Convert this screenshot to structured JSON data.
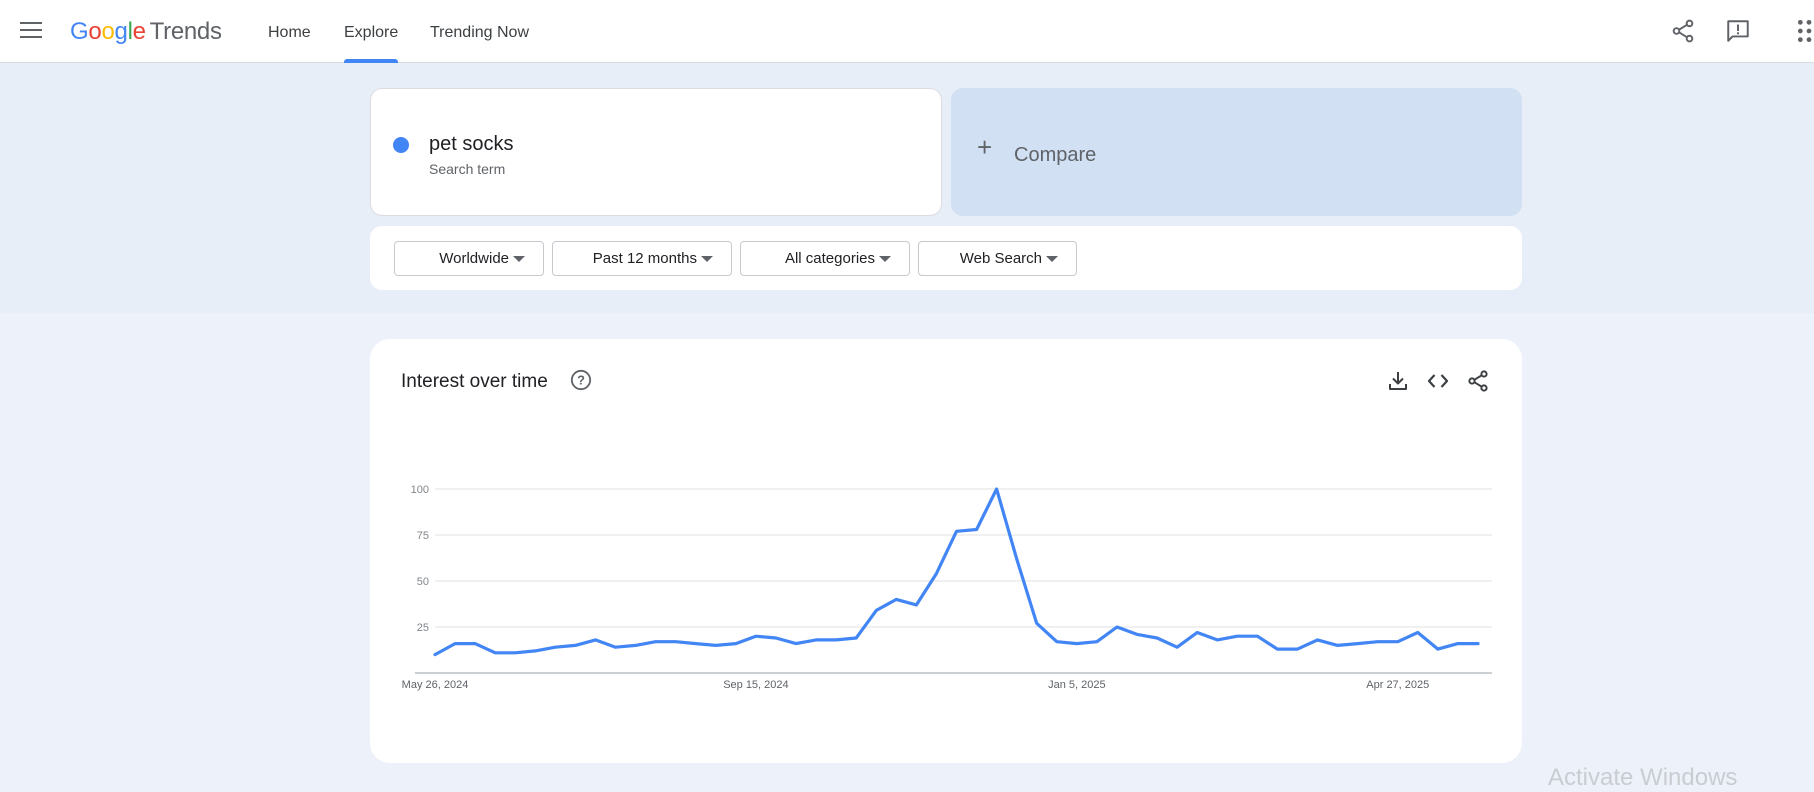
{
  "header": {
    "logo": {
      "letters": [
        "G",
        "o",
        "o",
        "g",
        "l",
        "e"
      ],
      "product": "Trends"
    },
    "nav": [
      {
        "label": "Home",
        "active": false
      },
      {
        "label": "Explore",
        "active": true
      },
      {
        "label": "Trending Now",
        "active": false
      }
    ],
    "icons": [
      "menu-icon",
      "share-icon",
      "feedback-icon",
      "apps-icon"
    ]
  },
  "search_term": {
    "name": "pet socks",
    "type": "Search term",
    "color": "#4285f4"
  },
  "compare": {
    "label": "Compare"
  },
  "filters": [
    {
      "label": "Worldwide"
    },
    {
      "label": "Past 12 months"
    },
    {
      "label": "All categories"
    },
    {
      "label": "Web Search"
    }
  ],
  "interest": {
    "title": "Interest over time",
    "tools": [
      "download-icon",
      "embed-icon",
      "share-icon"
    ]
  },
  "chart_data": {
    "type": "line",
    "title": "Interest over time",
    "xlabel": "",
    "ylabel": "",
    "ylim": [
      0,
      100
    ],
    "yticks": [
      25,
      50,
      75,
      100
    ],
    "x_tick_labels": [
      "May 26, 2024",
      "Sep 15, 2024",
      "Jan 5, 2025",
      "Apr 27, 2025"
    ],
    "x_tick_indices": [
      0,
      16,
      32,
      48
    ],
    "grid": true,
    "legend": "none",
    "series": [
      {
        "color": "#4285f4",
        "values": [
          10,
          16,
          16,
          11,
          11,
          12,
          14,
          15,
          18,
          14,
          15,
          17,
          17,
          16,
          15,
          16,
          20,
          19,
          16,
          18,
          18,
          19,
          34,
          40,
          37,
          54,
          77,
          78,
          100,
          62,
          27,
          17,
          16,
          17,
          25,
          21,
          19,
          14,
          22,
          18,
          20,
          20,
          13,
          13,
          18,
          15,
          16,
          17,
          17,
          22,
          13,
          16,
          16
        ]
      }
    ]
  },
  "watermark": "Activate Windows"
}
